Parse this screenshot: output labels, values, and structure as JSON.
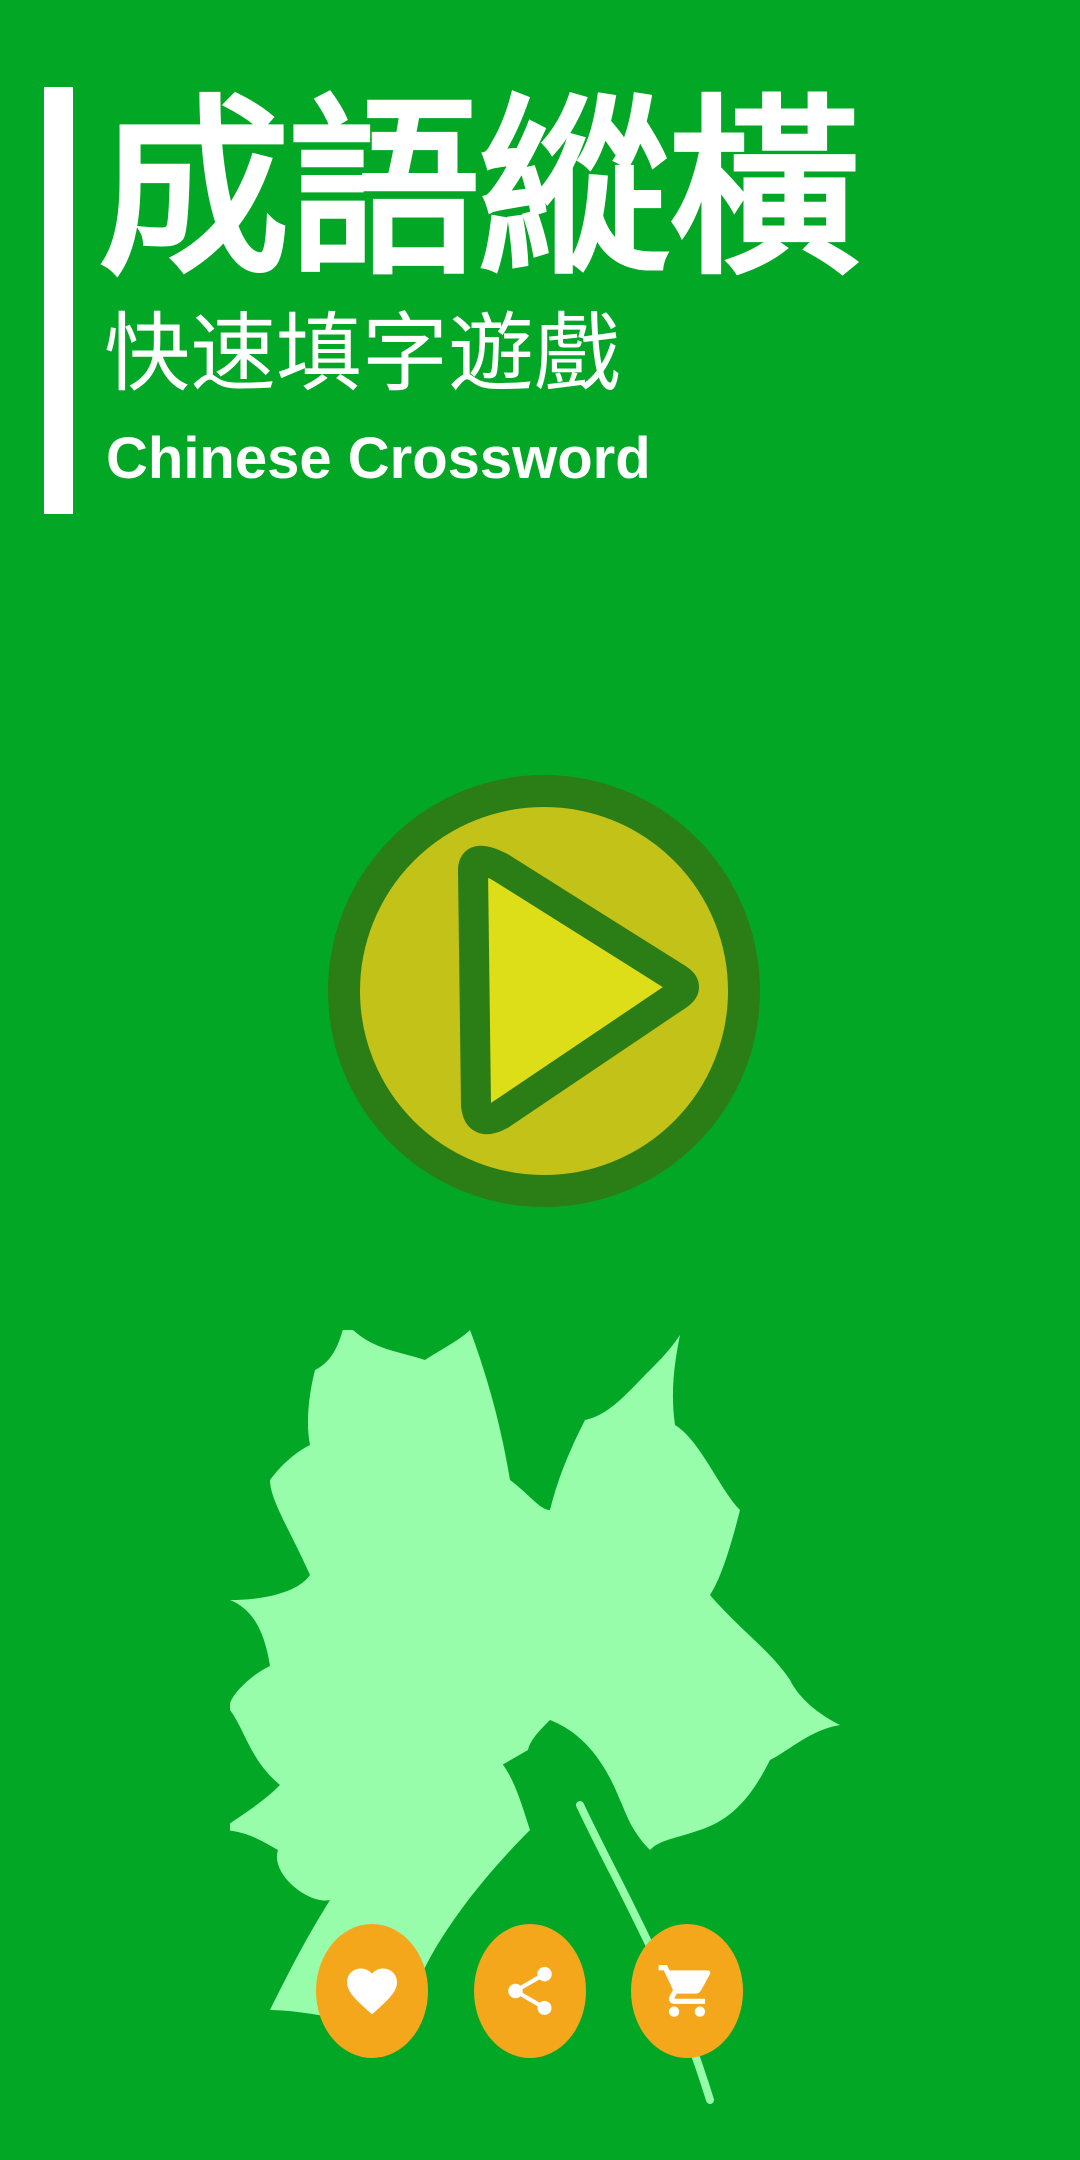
{
  "game": {
    "title": "成語縱橫",
    "subtitle": "快速填字遊戲",
    "english_title": "Chinese Crossword"
  },
  "colors": {
    "background": "#03a726",
    "play_ring": "#2b7d16",
    "play_fill": "#c2c218",
    "play_triangle": "#dddd18",
    "leaf": "#98fdab",
    "action_button": "#f5a71c",
    "icon": "#ffffff"
  },
  "actions": [
    {
      "id": "like",
      "icon": "heart-icon"
    },
    {
      "id": "share",
      "icon": "share-icon"
    },
    {
      "id": "shop",
      "icon": "cart-icon"
    }
  ],
  "decor": {
    "icon": "maple-leaf-icon"
  }
}
